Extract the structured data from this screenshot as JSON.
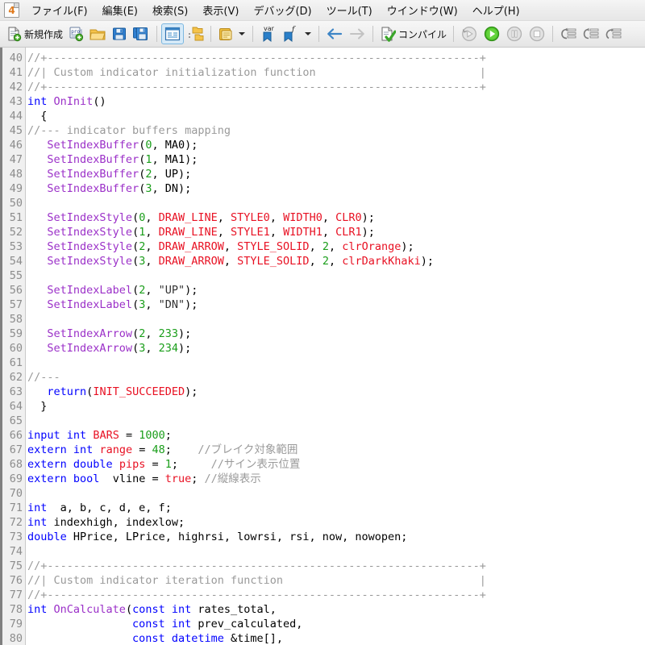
{
  "window": {
    "app_icon": "mql-app-icon",
    "app_icon_char": "4"
  },
  "menubar": {
    "items": [
      {
        "label": "ファイル(F)",
        "name": "menu-file"
      },
      {
        "label": "編集(E)",
        "name": "menu-edit"
      },
      {
        "label": "検索(S)",
        "name": "menu-search"
      },
      {
        "label": "表示(V)",
        "name": "menu-view"
      },
      {
        "label": "デバッグ(D)",
        "name": "menu-debug"
      },
      {
        "label": "ツール(T)",
        "name": "menu-tools"
      },
      {
        "label": "ウインドウ(W)",
        "name": "menu-window"
      },
      {
        "label": "ヘルプ(H)",
        "name": "menu-help"
      }
    ]
  },
  "toolbar": {
    "new_label": "新規作成",
    "compile_label": "コンパイル",
    "buttons": [
      {
        "name": "new-file-button",
        "icon": "new-document-icon"
      },
      {
        "name": "new-project-button",
        "icon": "new-project-icon"
      },
      {
        "name": "open-button",
        "icon": "open-folder-icon"
      },
      {
        "name": "save-button",
        "icon": "save-floppy-icon"
      },
      {
        "name": "save-all-button",
        "icon": "save-all-floppy-icon"
      },
      {
        "name": "toggle-navigator-button",
        "icon": "navigator-panel-icon"
      },
      {
        "name": "toggle-toolbox-button",
        "icon": "toolbox-folders-icon"
      },
      {
        "name": "clipboard-button",
        "icon": "clipboard-icon"
      },
      {
        "name": "insert-variable-button",
        "icon": "variable-bookmark-icon"
      },
      {
        "name": "insert-function-button",
        "icon": "function-bookmark-icon"
      },
      {
        "name": "navigate-back-button",
        "icon": "arrow-left-icon"
      },
      {
        "name": "navigate-forward-button",
        "icon": "arrow-right-icon"
      },
      {
        "name": "compile-button",
        "icon": "compile-check-icon"
      },
      {
        "name": "debug-restart-button",
        "icon": "debug-restart-icon"
      },
      {
        "name": "debug-start-button",
        "icon": "debug-play-icon"
      },
      {
        "name": "debug-pause-button",
        "icon": "debug-pause-icon"
      },
      {
        "name": "debug-stop-button",
        "icon": "debug-stop-icon"
      },
      {
        "name": "step-into-button",
        "icon": "step-into-icon"
      },
      {
        "name": "step-over-button",
        "icon": "step-over-icon"
      },
      {
        "name": "step-out-button",
        "icon": "step-out-icon"
      }
    ]
  },
  "editor": {
    "first_line_number": 40,
    "lines": [
      {
        "n": 40,
        "tokens": [
          {
            "t": "//+------------------------------------------------------------------+",
            "c": "cmt"
          }
        ]
      },
      {
        "n": 41,
        "tokens": [
          {
            "t": "//| Custom indicator initialization function                         |",
            "c": "cmt"
          }
        ]
      },
      {
        "n": 42,
        "tokens": [
          {
            "t": "//+------------------------------------------------------------------+",
            "c": "cmt"
          }
        ]
      },
      {
        "n": 43,
        "tokens": [
          {
            "t": "int",
            "c": "kw"
          },
          {
            "t": " ",
            "c": "def"
          },
          {
            "t": "OnInit",
            "c": "fn"
          },
          {
            "t": "()",
            "c": "op"
          }
        ]
      },
      {
        "n": 44,
        "tokens": [
          {
            "t": "  {",
            "c": "op"
          }
        ]
      },
      {
        "n": 45,
        "tokens": [
          {
            "t": "//--- indicator buffers mapping",
            "c": "cmt"
          }
        ]
      },
      {
        "n": 46,
        "tokens": [
          {
            "t": "   ",
            "c": "def"
          },
          {
            "t": "SetIndexBuffer",
            "c": "fn"
          },
          {
            "t": "(",
            "c": "op"
          },
          {
            "t": "0",
            "c": "num"
          },
          {
            "t": ", MA0);",
            "c": "def"
          }
        ]
      },
      {
        "n": 47,
        "tokens": [
          {
            "t": "   ",
            "c": "def"
          },
          {
            "t": "SetIndexBuffer",
            "c": "fn"
          },
          {
            "t": "(",
            "c": "op"
          },
          {
            "t": "1",
            "c": "num"
          },
          {
            "t": ", MA1);",
            "c": "def"
          }
        ]
      },
      {
        "n": 48,
        "tokens": [
          {
            "t": "   ",
            "c": "def"
          },
          {
            "t": "SetIndexBuffer",
            "c": "fn"
          },
          {
            "t": "(",
            "c": "op"
          },
          {
            "t": "2",
            "c": "num"
          },
          {
            "t": ", UP);",
            "c": "def"
          }
        ]
      },
      {
        "n": 49,
        "tokens": [
          {
            "t": "   ",
            "c": "def"
          },
          {
            "t": "SetIndexBuffer",
            "c": "fn"
          },
          {
            "t": "(",
            "c": "op"
          },
          {
            "t": "3",
            "c": "num"
          },
          {
            "t": ", DN);",
            "c": "def"
          }
        ]
      },
      {
        "n": 50,
        "tokens": []
      },
      {
        "n": 51,
        "tokens": [
          {
            "t": "   ",
            "c": "def"
          },
          {
            "t": "SetIndexStyle",
            "c": "fn"
          },
          {
            "t": "(",
            "c": "op"
          },
          {
            "t": "0",
            "c": "num"
          },
          {
            "t": ", ",
            "c": "def"
          },
          {
            "t": "DRAW_LINE",
            "c": "const"
          },
          {
            "t": ", ",
            "c": "def"
          },
          {
            "t": "STYLE0",
            "c": "const"
          },
          {
            "t": ", ",
            "c": "def"
          },
          {
            "t": "WIDTH0",
            "c": "const"
          },
          {
            "t": ", ",
            "c": "def"
          },
          {
            "t": "CLR0",
            "c": "const"
          },
          {
            "t": ");",
            "c": "op"
          }
        ]
      },
      {
        "n": 52,
        "tokens": [
          {
            "t": "   ",
            "c": "def"
          },
          {
            "t": "SetIndexStyle",
            "c": "fn"
          },
          {
            "t": "(",
            "c": "op"
          },
          {
            "t": "1",
            "c": "num"
          },
          {
            "t": ", ",
            "c": "def"
          },
          {
            "t": "DRAW_LINE",
            "c": "const"
          },
          {
            "t": ", ",
            "c": "def"
          },
          {
            "t": "STYLE1",
            "c": "const"
          },
          {
            "t": ", ",
            "c": "def"
          },
          {
            "t": "WIDTH1",
            "c": "const"
          },
          {
            "t": ", ",
            "c": "def"
          },
          {
            "t": "CLR1",
            "c": "const"
          },
          {
            "t": ");",
            "c": "op"
          }
        ]
      },
      {
        "n": 53,
        "tokens": [
          {
            "t": "   ",
            "c": "def"
          },
          {
            "t": "SetIndexStyle",
            "c": "fn"
          },
          {
            "t": "(",
            "c": "op"
          },
          {
            "t": "2",
            "c": "num"
          },
          {
            "t": ", ",
            "c": "def"
          },
          {
            "t": "DRAW_ARROW",
            "c": "const"
          },
          {
            "t": ", ",
            "c": "def"
          },
          {
            "t": "STYLE_SOLID",
            "c": "const"
          },
          {
            "t": ", ",
            "c": "def"
          },
          {
            "t": "2",
            "c": "num"
          },
          {
            "t": ", ",
            "c": "def"
          },
          {
            "t": "clrOrange",
            "c": "const"
          },
          {
            "t": ");",
            "c": "op"
          }
        ]
      },
      {
        "n": 54,
        "tokens": [
          {
            "t": "   ",
            "c": "def"
          },
          {
            "t": "SetIndexStyle",
            "c": "fn"
          },
          {
            "t": "(",
            "c": "op"
          },
          {
            "t": "3",
            "c": "num"
          },
          {
            "t": ", ",
            "c": "def"
          },
          {
            "t": "DRAW_ARROW",
            "c": "const"
          },
          {
            "t": ", ",
            "c": "def"
          },
          {
            "t": "STYLE_SOLID",
            "c": "const"
          },
          {
            "t": ", ",
            "c": "def"
          },
          {
            "t": "2",
            "c": "num"
          },
          {
            "t": ", ",
            "c": "def"
          },
          {
            "t": "clrDarkKhaki",
            "c": "const"
          },
          {
            "t": ");",
            "c": "op"
          }
        ]
      },
      {
        "n": 55,
        "tokens": []
      },
      {
        "n": 56,
        "tokens": [
          {
            "t": "   ",
            "c": "def"
          },
          {
            "t": "SetIndexLabel",
            "c": "fn"
          },
          {
            "t": "(",
            "c": "op"
          },
          {
            "t": "2",
            "c": "num"
          },
          {
            "t": ", ",
            "c": "def"
          },
          {
            "t": "\"UP\"",
            "c": "str"
          },
          {
            "t": ");",
            "c": "op"
          }
        ]
      },
      {
        "n": 57,
        "tokens": [
          {
            "t": "   ",
            "c": "def"
          },
          {
            "t": "SetIndexLabel",
            "c": "fn"
          },
          {
            "t": "(",
            "c": "op"
          },
          {
            "t": "3",
            "c": "num"
          },
          {
            "t": ", ",
            "c": "def"
          },
          {
            "t": "\"DN\"",
            "c": "str"
          },
          {
            "t": ");",
            "c": "op"
          }
        ]
      },
      {
        "n": 58,
        "tokens": []
      },
      {
        "n": 59,
        "tokens": [
          {
            "t": "   ",
            "c": "def"
          },
          {
            "t": "SetIndexArrow",
            "c": "fn"
          },
          {
            "t": "(",
            "c": "op"
          },
          {
            "t": "2",
            "c": "num"
          },
          {
            "t": ", ",
            "c": "def"
          },
          {
            "t": "233",
            "c": "num"
          },
          {
            "t": ");",
            "c": "op"
          }
        ]
      },
      {
        "n": 60,
        "tokens": [
          {
            "t": "   ",
            "c": "def"
          },
          {
            "t": "SetIndexArrow",
            "c": "fn"
          },
          {
            "t": "(",
            "c": "op"
          },
          {
            "t": "3",
            "c": "num"
          },
          {
            "t": ", ",
            "c": "def"
          },
          {
            "t": "234",
            "c": "num"
          },
          {
            "t": ");",
            "c": "op"
          }
        ]
      },
      {
        "n": 61,
        "tokens": []
      },
      {
        "n": 62,
        "tokens": [
          {
            "t": "//---",
            "c": "cmt"
          }
        ]
      },
      {
        "n": 63,
        "tokens": [
          {
            "t": "   ",
            "c": "def"
          },
          {
            "t": "return",
            "c": "kw"
          },
          {
            "t": "(",
            "c": "op"
          },
          {
            "t": "INIT_SUCCEEDED",
            "c": "const"
          },
          {
            "t": ");",
            "c": "op"
          }
        ]
      },
      {
        "n": 64,
        "tokens": [
          {
            "t": "  }",
            "c": "op"
          }
        ]
      },
      {
        "n": 65,
        "tokens": []
      },
      {
        "n": 66,
        "tokens": [
          {
            "t": "input",
            "c": "kw"
          },
          {
            "t": " ",
            "c": "def"
          },
          {
            "t": "int",
            "c": "kw"
          },
          {
            "t": " ",
            "c": "def"
          },
          {
            "t": "BARS",
            "c": "const"
          },
          {
            "t": " = ",
            "c": "def"
          },
          {
            "t": "1000",
            "c": "num"
          },
          {
            "t": ";",
            "c": "op"
          }
        ]
      },
      {
        "n": 67,
        "tokens": [
          {
            "t": "extern",
            "c": "kw"
          },
          {
            "t": " ",
            "c": "def"
          },
          {
            "t": "int",
            "c": "kw"
          },
          {
            "t": " ",
            "c": "def"
          },
          {
            "t": "range",
            "c": "const"
          },
          {
            "t": " = ",
            "c": "def"
          },
          {
            "t": "48",
            "c": "num"
          },
          {
            "t": ";",
            "c": "op"
          },
          {
            "t": "    ",
            "c": "def"
          },
          {
            "t": "//ブレイク対象範囲",
            "c": "cmt"
          }
        ]
      },
      {
        "n": 68,
        "tokens": [
          {
            "t": "extern",
            "c": "kw"
          },
          {
            "t": " ",
            "c": "def"
          },
          {
            "t": "double",
            "c": "kw"
          },
          {
            "t": " ",
            "c": "def"
          },
          {
            "t": "pips",
            "c": "const"
          },
          {
            "t": " = ",
            "c": "def"
          },
          {
            "t": "1",
            "c": "num"
          },
          {
            "t": ";",
            "c": "op"
          },
          {
            "t": "     ",
            "c": "def"
          },
          {
            "t": "//サイン表示位置",
            "c": "cmt"
          }
        ]
      },
      {
        "n": 69,
        "tokens": [
          {
            "t": "extern",
            "c": "kw"
          },
          {
            "t": " ",
            "c": "def"
          },
          {
            "t": "bool",
            "c": "kw"
          },
          {
            "t": "  vline = ",
            "c": "def"
          },
          {
            "t": "true",
            "c": "const"
          },
          {
            "t": "; ",
            "c": "op"
          },
          {
            "t": "//縦線表示",
            "c": "cmt"
          }
        ]
      },
      {
        "n": 70,
        "tokens": []
      },
      {
        "n": 71,
        "tokens": [
          {
            "t": "int",
            "c": "kw"
          },
          {
            "t": "  a, b, c, d, e, f;",
            "c": "def"
          }
        ]
      },
      {
        "n": 72,
        "tokens": [
          {
            "t": "int",
            "c": "kw"
          },
          {
            "t": " indexhigh, indexlow;",
            "c": "def"
          }
        ]
      },
      {
        "n": 73,
        "tokens": [
          {
            "t": "double",
            "c": "kw"
          },
          {
            "t": " HPrice, LPrice, highrsi, lowrsi, rsi, now, nowopen;",
            "c": "def"
          }
        ]
      },
      {
        "n": 74,
        "tokens": []
      },
      {
        "n": 75,
        "tokens": [
          {
            "t": "//+------------------------------------------------------------------+",
            "c": "cmt"
          }
        ]
      },
      {
        "n": 76,
        "tokens": [
          {
            "t": "//| Custom indicator iteration function                              |",
            "c": "cmt"
          }
        ]
      },
      {
        "n": 77,
        "tokens": [
          {
            "t": "//+------------------------------------------------------------------+",
            "c": "cmt"
          }
        ]
      },
      {
        "n": 78,
        "tokens": [
          {
            "t": "int",
            "c": "kw"
          },
          {
            "t": " ",
            "c": "def"
          },
          {
            "t": "OnCalculate",
            "c": "fn"
          },
          {
            "t": "(",
            "c": "op"
          },
          {
            "t": "const",
            "c": "kw"
          },
          {
            "t": " ",
            "c": "def"
          },
          {
            "t": "int",
            "c": "kw"
          },
          {
            "t": " rates_total,",
            "c": "def"
          }
        ]
      },
      {
        "n": 79,
        "tokens": [
          {
            "t": "                ",
            "c": "def"
          },
          {
            "t": "const",
            "c": "kw"
          },
          {
            "t": " ",
            "c": "def"
          },
          {
            "t": "int",
            "c": "kw"
          },
          {
            "t": " prev_calculated,",
            "c": "def"
          }
        ]
      },
      {
        "n": 80,
        "tokens": [
          {
            "t": "                ",
            "c": "def"
          },
          {
            "t": "const",
            "c": "kw"
          },
          {
            "t": " ",
            "c": "def"
          },
          {
            "t": "datetime",
            "c": "kw"
          },
          {
            "t": " &time[],",
            "c": "def"
          }
        ]
      }
    ]
  },
  "colors": {
    "keyword": "#0000ff",
    "function": "#9b30c8",
    "number": "#1a9e1a",
    "constant": "#e81123",
    "comment": "#9a9a9a",
    "string": "#333333",
    "default": "#000000",
    "gutter_bg": "#f0f0f0",
    "editor_bg": "#ffffff"
  }
}
